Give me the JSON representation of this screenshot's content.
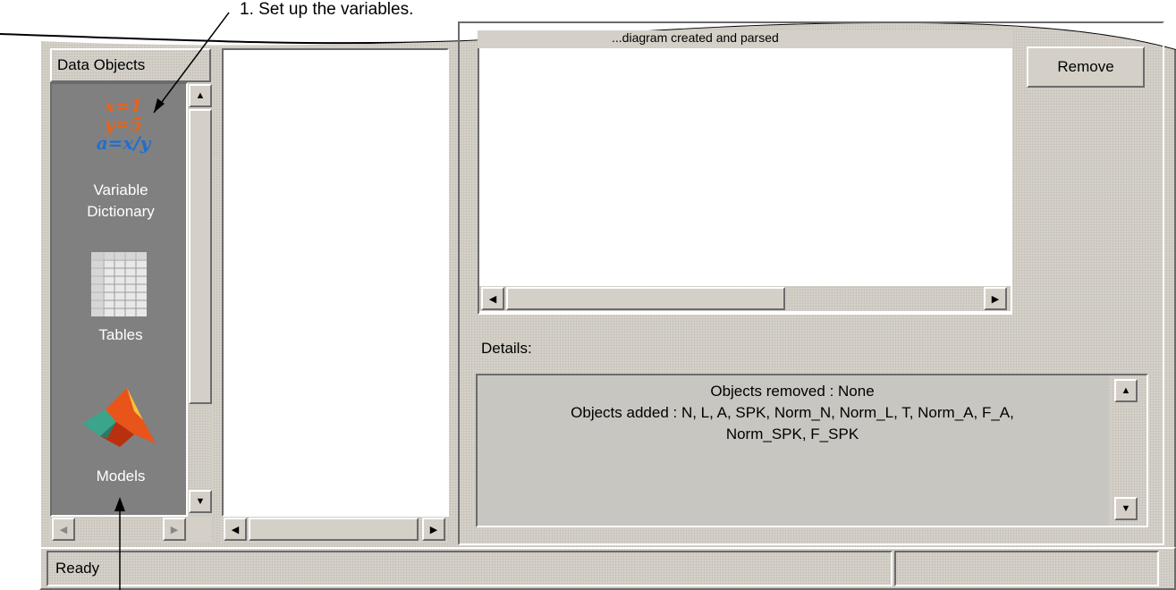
{
  "callouts": {
    "top": "1. Set up the variables."
  },
  "palette": {
    "tab_label": "Data Objects",
    "items": [
      {
        "label_line1": "Variable",
        "label_line2": "Dictionary",
        "icon": "variable-dictionary-icon",
        "icon_text": [
          "x=1",
          "y=5",
          "a=x/y"
        ]
      },
      {
        "label": "Tables",
        "icon": "table-icon"
      },
      {
        "label": "Models",
        "icon": "matlab-membrane-icon"
      }
    ]
  },
  "message": {
    "title": "...diagram created and parsed"
  },
  "remove_button": "Remove",
  "details": {
    "label": "Details:",
    "lines": [
      "Objects removed : None",
      "Objects added : N, L, A, SPK, Norm_N, Norm_L, T, Norm_A, F_A,",
      "Norm_SPK, F_SPK"
    ]
  },
  "status": {
    "text": "Ready",
    "right": ""
  },
  "colors": {
    "face": "#d4d0c8",
    "palette_bg": "#808080",
    "icon_orange": "#e8621a",
    "icon_blue": "#1e6fd0"
  }
}
